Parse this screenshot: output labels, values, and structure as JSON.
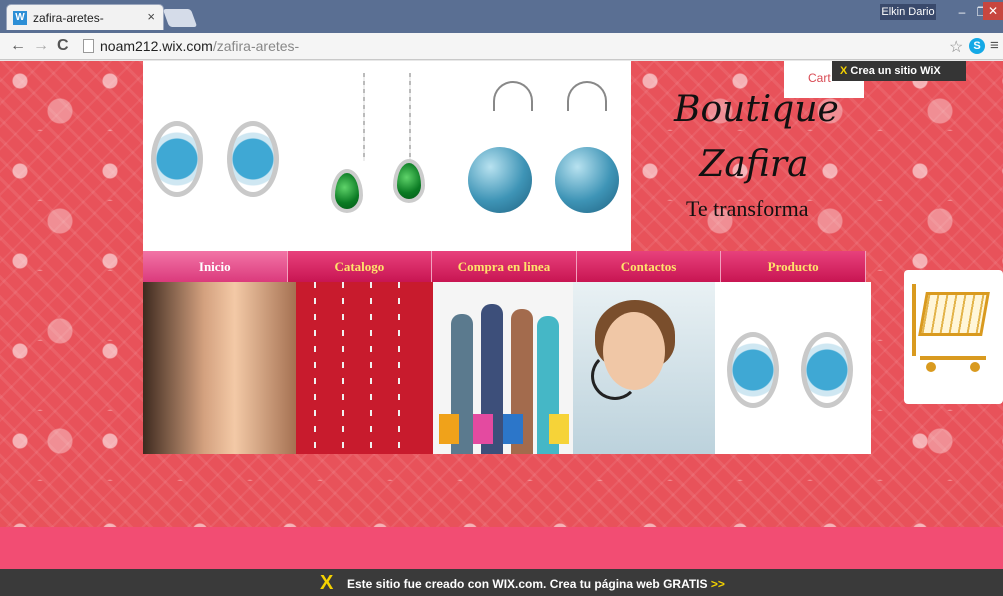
{
  "browser": {
    "tab_title": "zafira-aretes-",
    "tab_close": "×",
    "user": "Elkin Dario",
    "win_min": "–",
    "win_max": "❐",
    "win_close": "✕",
    "url_host": "noam212.wix.com",
    "url_path": "/zafira-aretes-",
    "back": "←",
    "forward": "→",
    "reload": "C",
    "star": "☆",
    "menu": "≡",
    "skype": "S"
  },
  "site": {
    "brand_line1": "Boutique",
    "brand_line2": "Zafira",
    "tagline": "Te transforma",
    "cart_label": "Cart",
    "wix_cta_mark": "X",
    "wix_cta": "Crea un sitio WiX",
    "nav": [
      {
        "label": "Inicio"
      },
      {
        "label": "Catalogo"
      },
      {
        "label": "Compra en linea"
      },
      {
        "label": "Contactos"
      },
      {
        "label": "Producto"
      }
    ],
    "footer_logo": "X",
    "footer_text": "Este sitio fue creado con WIX.com. Crea tu página web GRATIS",
    "footer_arrow": ">>"
  }
}
